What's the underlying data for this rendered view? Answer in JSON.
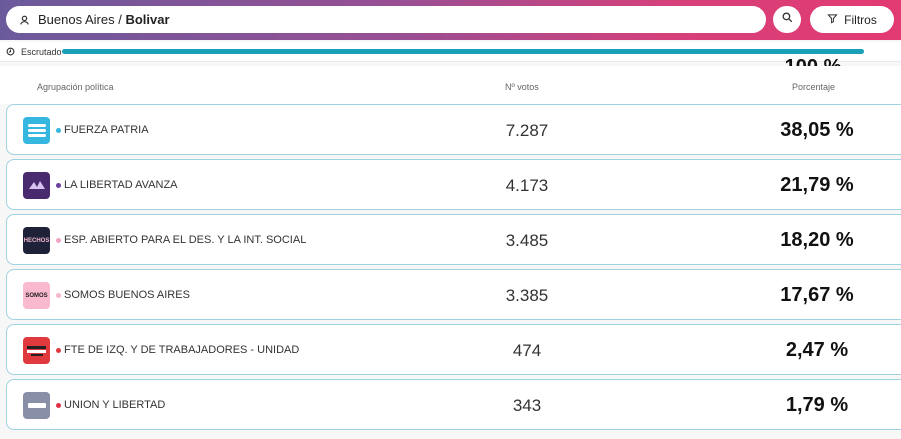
{
  "search": {
    "location_prefix": "Buenos Aires / ",
    "location_bold": "Bolivar",
    "filter_label": "Filtros"
  },
  "progress": {
    "label": "Escrutado",
    "value_text": "100 %",
    "fraction": 1.0
  },
  "table": {
    "headers": {
      "party": "Agrupación política",
      "votes": "Nº votos",
      "percent": "Porcentaje"
    },
    "rows": [
      {
        "name": "FUERZA PATRIA",
        "votes": "7.287",
        "percent": "38,05 %",
        "dot_color": "#35b7e0",
        "logo_icon": "fuerza-patria-logo"
      },
      {
        "name": "LA LIBERTAD AVANZA",
        "votes": "4.173",
        "percent": "21,79 %",
        "dot_color": "#6b3fa0",
        "logo_icon": "la-libertad-avanza-logo"
      },
      {
        "name": "ESP. ABIERTO PARA EL DES. Y LA INT. SOCIAL",
        "votes": "3.485",
        "percent": "18,20 %",
        "dot_color": "#f0a3c4",
        "logo_icon": "hechos-logo",
        "logo_text": "HECHOS"
      },
      {
        "name": "SOMOS BUENOS AIRES",
        "votes": "3.385",
        "percent": "17,67 %",
        "dot_color": "#f6b6cc",
        "logo_icon": "somos-logo",
        "logo_text": "SOMOS"
      },
      {
        "name": "FTE DE IZQ. Y DE TRABAJADORES - UNIDAD",
        "votes": "474",
        "percent": "2,47 %",
        "dot_color": "#e03a3e",
        "logo_icon": "fit-unidad-logo"
      },
      {
        "name": "UNION Y LIBERTAD",
        "votes": "343",
        "percent": "1,79 %",
        "dot_color": "#e0304a",
        "logo_icon": "union-y-libertad-logo"
      }
    ]
  },
  "colors": {
    "accent": "#1a9fb8",
    "row_border": "#9fd3df"
  }
}
